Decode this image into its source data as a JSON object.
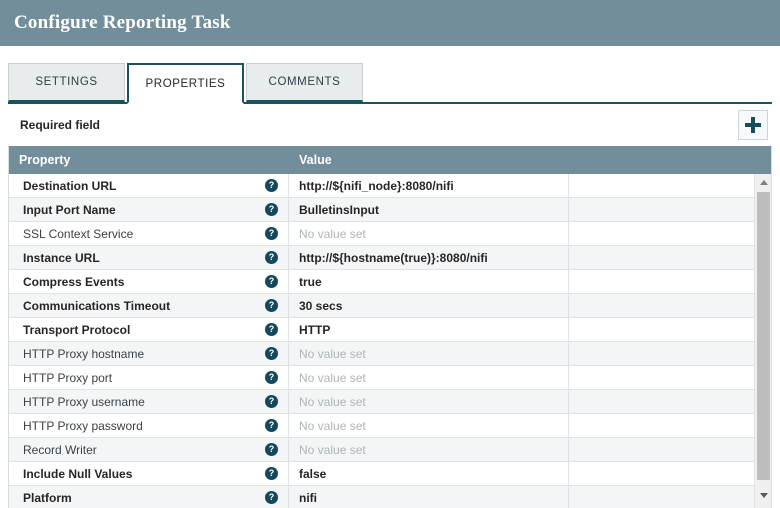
{
  "dialog": {
    "title": "Configure Reporting Task"
  },
  "tabs": [
    {
      "label": "SETTINGS",
      "active": false
    },
    {
      "label": "PROPERTIES",
      "active": true
    },
    {
      "label": "COMMENTS",
      "active": false
    }
  ],
  "toolbar": {
    "required_field_label": "Required field",
    "add_button_icon": "plus-icon"
  },
  "table": {
    "columns": [
      "Property",
      "Value"
    ],
    "help_icon_glyph": "?",
    "no_value_text": "No value set",
    "rows": [
      {
        "property": "Destination URL",
        "required": true,
        "value": "http://${nifi_node}:8080/nifi",
        "has_value": true
      },
      {
        "property": "Input Port Name",
        "required": true,
        "value": "BulletinsInput",
        "has_value": true
      },
      {
        "property": "SSL Context Service",
        "required": false,
        "value": "No value set",
        "has_value": false
      },
      {
        "property": "Instance URL",
        "required": true,
        "value": "http://${hostname(true)}:8080/nifi",
        "has_value": true
      },
      {
        "property": "Compress Events",
        "required": true,
        "value": "true",
        "has_value": true
      },
      {
        "property": "Communications Timeout",
        "required": true,
        "value": "30 secs",
        "has_value": true
      },
      {
        "property": "Transport Protocol",
        "required": true,
        "value": "HTTP",
        "has_value": true
      },
      {
        "property": "HTTP Proxy hostname",
        "required": false,
        "value": "No value set",
        "has_value": false
      },
      {
        "property": "HTTP Proxy port",
        "required": false,
        "value": "No value set",
        "has_value": false
      },
      {
        "property": "HTTP Proxy username",
        "required": false,
        "value": "No value set",
        "has_value": false
      },
      {
        "property": "HTTP Proxy password",
        "required": false,
        "value": "No value set",
        "has_value": false
      },
      {
        "property": "Record Writer",
        "required": false,
        "value": "No value set",
        "has_value": false
      },
      {
        "property": "Include Null Values",
        "required": true,
        "value": "false",
        "has_value": true
      },
      {
        "property": "Platform",
        "required": true,
        "value": "nifi",
        "has_value": true
      }
    ]
  },
  "scrollbar": {
    "up_arrow_icon": "triangle-up-icon",
    "down_arrow_icon": "triangle-down-icon"
  },
  "colors": {
    "header_bar": "#728e9b",
    "tab_accent": "#19535c",
    "help_icon": "#14485c",
    "row_alt": "#f4f5f7",
    "unset_text": "#acb6bb"
  }
}
